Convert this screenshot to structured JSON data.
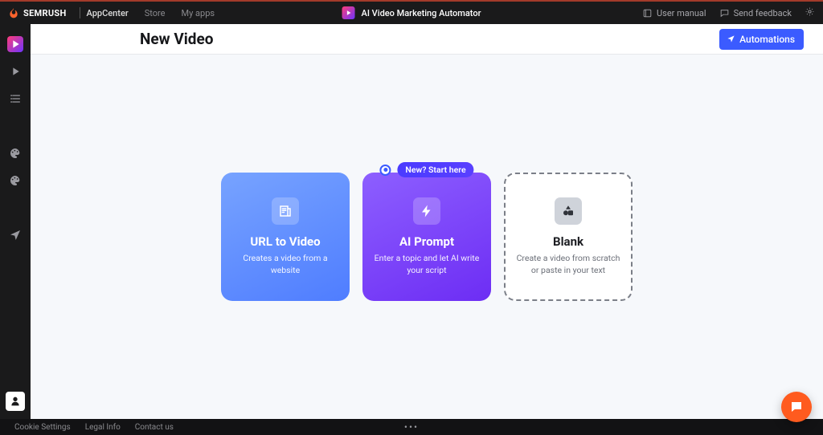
{
  "topbar": {
    "brand": "SEMRUSH",
    "appcenter": "AppCenter",
    "links": {
      "store": "Store",
      "myapps": "My apps"
    },
    "app_title": "AI Video Marketing Automator",
    "user_manual": "User manual",
    "send_feedback": "Send feedback"
  },
  "page": {
    "title": "New Video",
    "automations_btn": "Automations"
  },
  "cards": {
    "url": {
      "title": "URL to Video",
      "desc": "Creates a video from a website"
    },
    "ai": {
      "pill": "New? Start here",
      "title": "AI Prompt",
      "desc": "Enter a topic and let AI write your script"
    },
    "blank": {
      "title": "Blank",
      "desc": "Create a video from scratch or paste in your text"
    }
  },
  "footer": {
    "cookie": "Cookie Settings",
    "legal": "Legal Info",
    "contact": "Contact us"
  }
}
